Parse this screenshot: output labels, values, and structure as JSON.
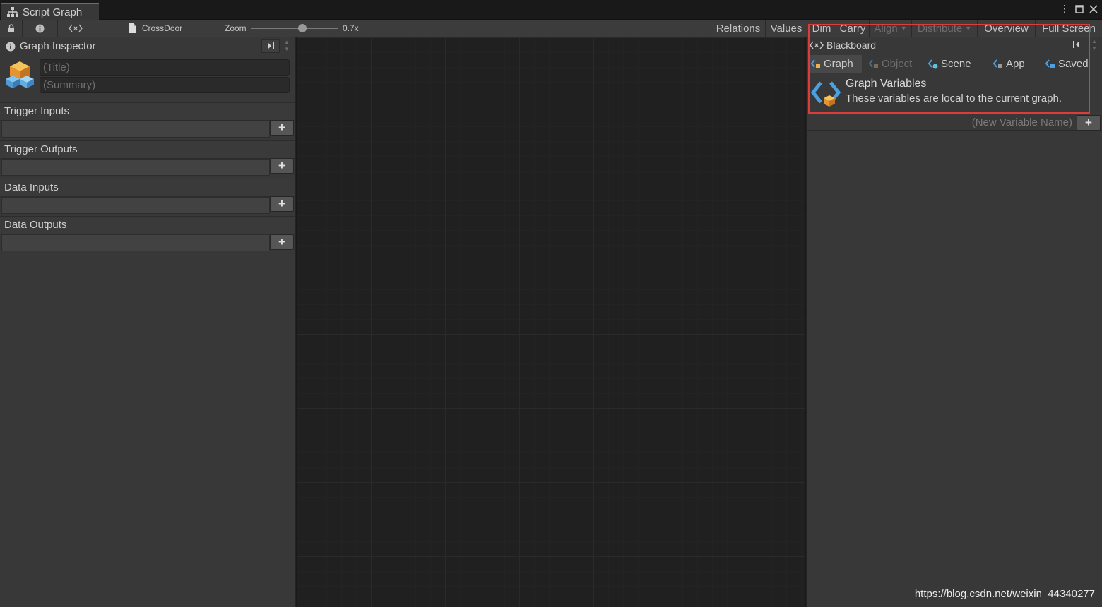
{
  "tab": {
    "title": "Script Graph"
  },
  "toolbar": {
    "graph_name": "CrossDoor",
    "zoom_label": "Zoom",
    "zoom_value": "0.7x",
    "zoom_level": 0.7,
    "buttons": {
      "relations": "Relations",
      "values": "Values",
      "dim": "Dim",
      "carry": "Carry",
      "align": "Align",
      "distribute": "Distribute",
      "overview": "Overview",
      "fullscreen": "Full Screen"
    }
  },
  "inspector": {
    "header": "Graph Inspector",
    "title_placeholder": "(Title)",
    "summary_placeholder": "(Summary)",
    "sections": {
      "trigger_inputs": "Trigger Inputs",
      "trigger_outputs": "Trigger Outputs",
      "data_inputs": "Data Inputs",
      "data_outputs": "Data Outputs"
    },
    "add_label": "+"
  },
  "blackboard": {
    "header": "Blackboard",
    "tabs": {
      "graph": "Graph",
      "object": "Object",
      "scene": "Scene",
      "app": "App",
      "saved": "Saved"
    },
    "info_title": "Graph Variables",
    "info_desc": "These variables are local to the current graph.",
    "new_var_placeholder": "(New Variable Name)",
    "add_label": "+"
  },
  "watermark": "https://blog.csdn.net/weixin_44340277",
  "colors": {
    "highlight": "#e03b3b",
    "tab_accent": "#3a79bb",
    "variable_icon": "#4aa0e0"
  }
}
